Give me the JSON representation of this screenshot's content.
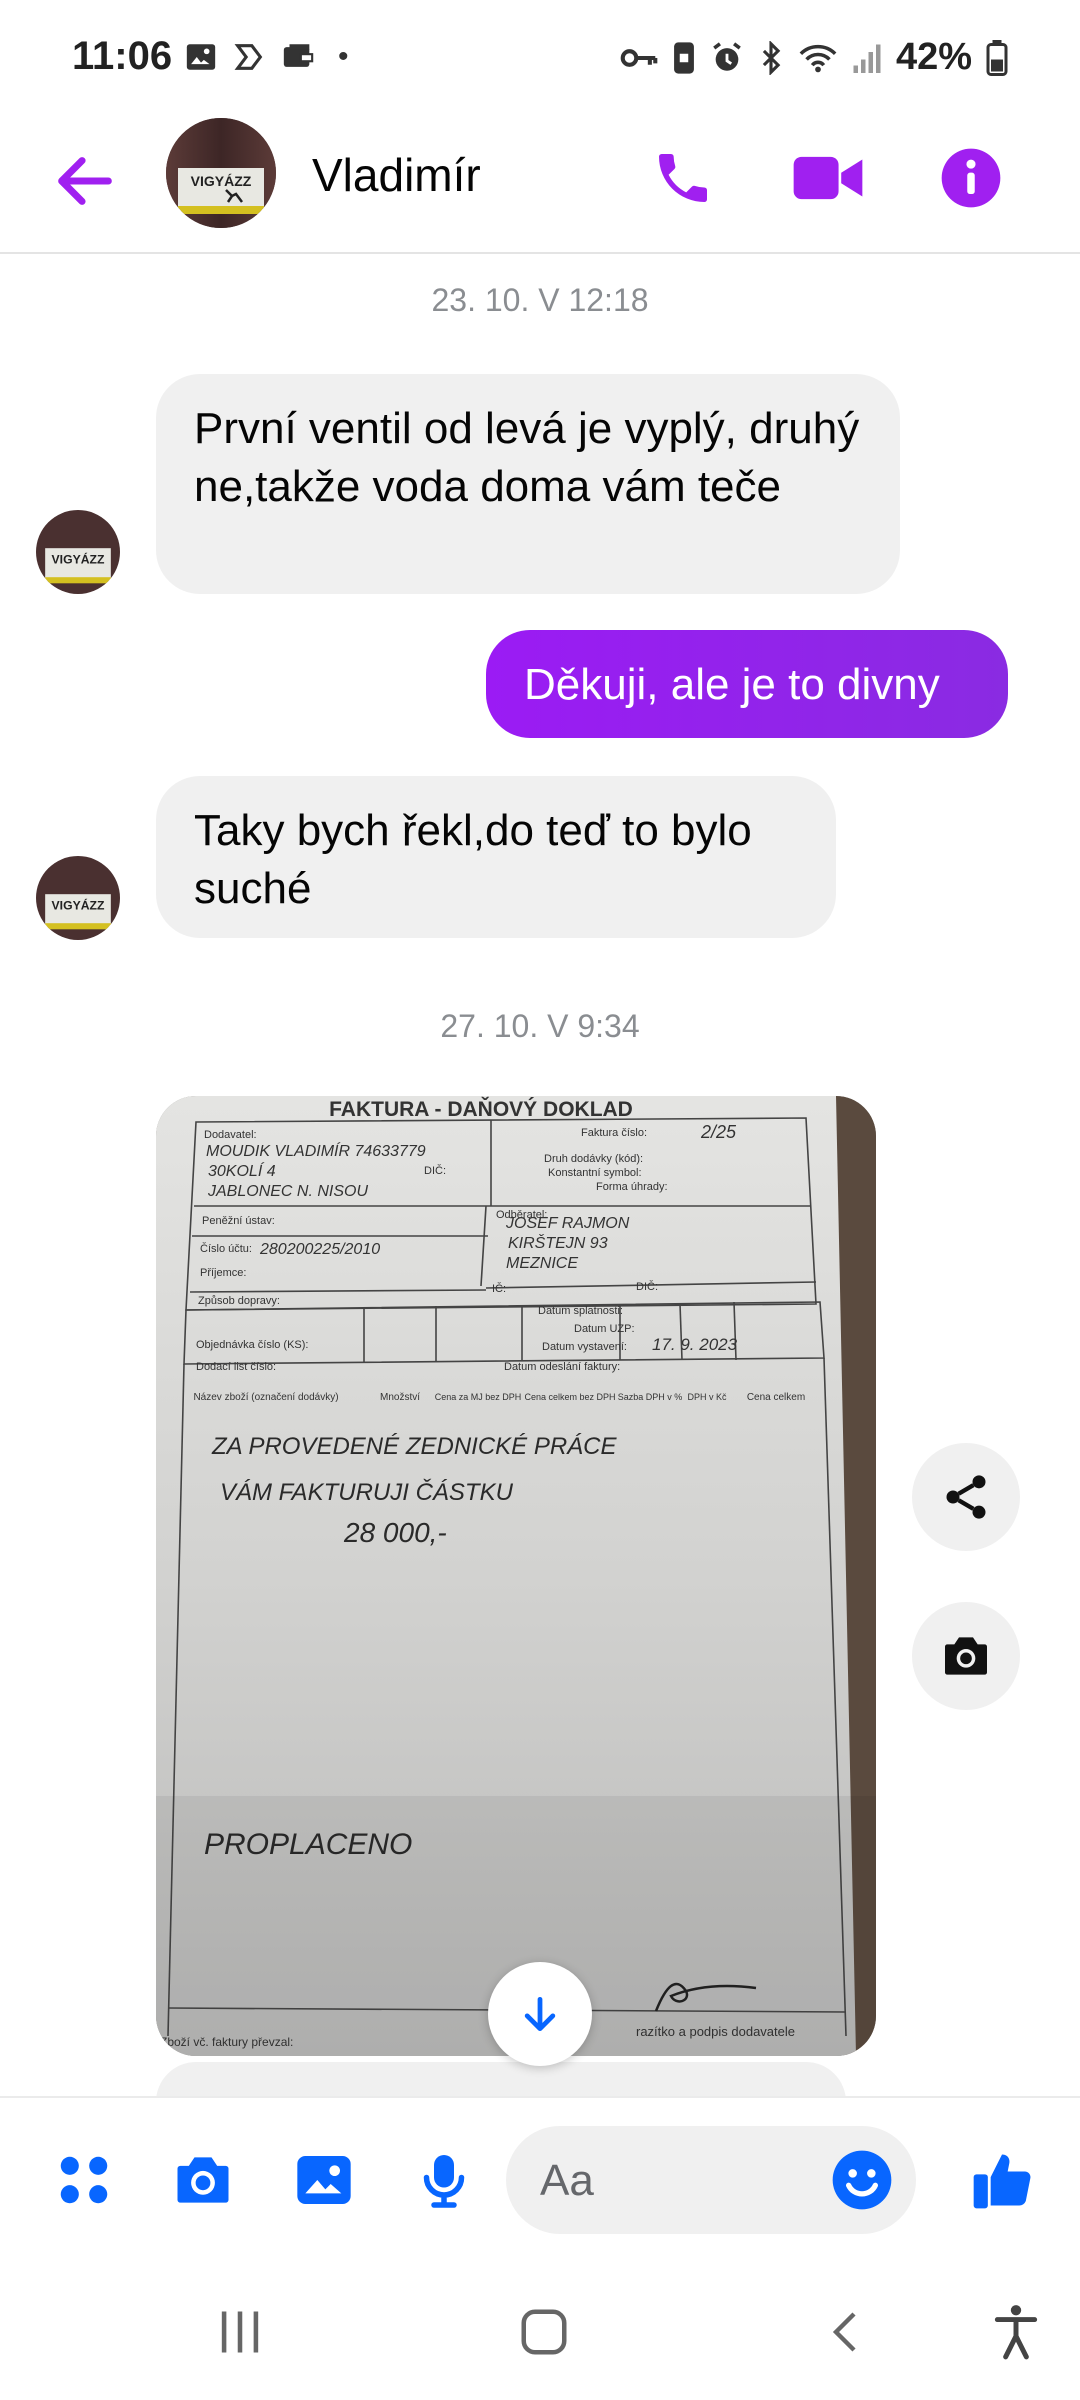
{
  "status_bar": {
    "time": "11:06",
    "dot": "•",
    "battery": "42%",
    "icons": [
      "image-icon",
      "swirl-icon",
      "wallet-icon",
      "key-icon",
      "phone-lock-icon",
      "alarm-icon",
      "bluetooth-icon",
      "wifi-icon",
      "signal-icon",
      "battery-icon"
    ]
  },
  "header": {
    "contact_name": "Vladimír",
    "avatar_text": "VIGYÁZZ",
    "accent_color": "#a020f0"
  },
  "chat": {
    "timestamp_1": "23. 10. V 12:18",
    "msg_1": "První ventil od levá je vyplý, druhý ne,takže voda doma vám teče",
    "msg_2": "Děkuji, ale je to divny",
    "msg_3": "Taky bych řekl,do teď to bylo suché",
    "timestamp_2": "27. 10. V 9:34"
  },
  "photo": {
    "title": "FAKTURA - DAŇOVÝ DOKLAD",
    "dodavatel_label": "Dodavatel:",
    "faktura_label": "Faktura číslo:",
    "faktura_value": "2/25",
    "supplier_lines": [
      "MOUDIK VLADIMÍR 74633779",
      "30KOLÍ 4",
      "JABLONEC N. NISOU"
    ],
    "dic_label": "DIČ:",
    "druh_label": "Druh dodávky (kód):",
    "konst_label": "Konstantní symbol:",
    "forma_label": "Forma úhrady:",
    "penezni_label": "Peněžní ústav:",
    "cislo_uctu_label": "Číslo účtu:",
    "cislo_uctu_value": "280200225/2010",
    "prijemce_label": "Příjemce:",
    "zpusob_label": "Způsob dopravy:",
    "odberatel_label": "Odběratel:",
    "odberatel_lines": [
      "JOSEF RAJMON",
      "KIRŠTEJN 93",
      "MEZNICE"
    ],
    "ic_label": "IČ:",
    "dic2_label": "DIČ:",
    "splatnost_label": "Datum splatnosti:",
    "uzp_label": "Datum UZP:",
    "vystaveni_label": "Datum vystavení:",
    "vystaveni_value": "17. 9. 2023",
    "objednavka_label": "Objednávka číslo (KS):",
    "dodaci_label": "Dodací list číslo:",
    "odeslani_label": "Datum odeslání faktury:",
    "col_1": "Název zboží (označení dodávky)",
    "col_2": "Množství",
    "col_3": "Cena za MJ bez DPH",
    "col_4": "Cena celkem bez DPH",
    "col_5": "Sazba DPH v %",
    "col_6": "DPH v Kč",
    "col_7": "Cena celkem",
    "hand_1": "ZA PROVEDENÉ ZEDNICKÉ PRÁCE",
    "hand_2": "VÁM FAKTURUJI ČÁSTKU",
    "hand_3": "28 000,-",
    "hand_4": "PROPLACENO",
    "footer_left": "Zboží vč. faktury převzal:",
    "footer_right": "razítko a podpis dodavatele"
  },
  "composer": {
    "placeholder": "Aa",
    "icon_color": "#0866ff"
  }
}
